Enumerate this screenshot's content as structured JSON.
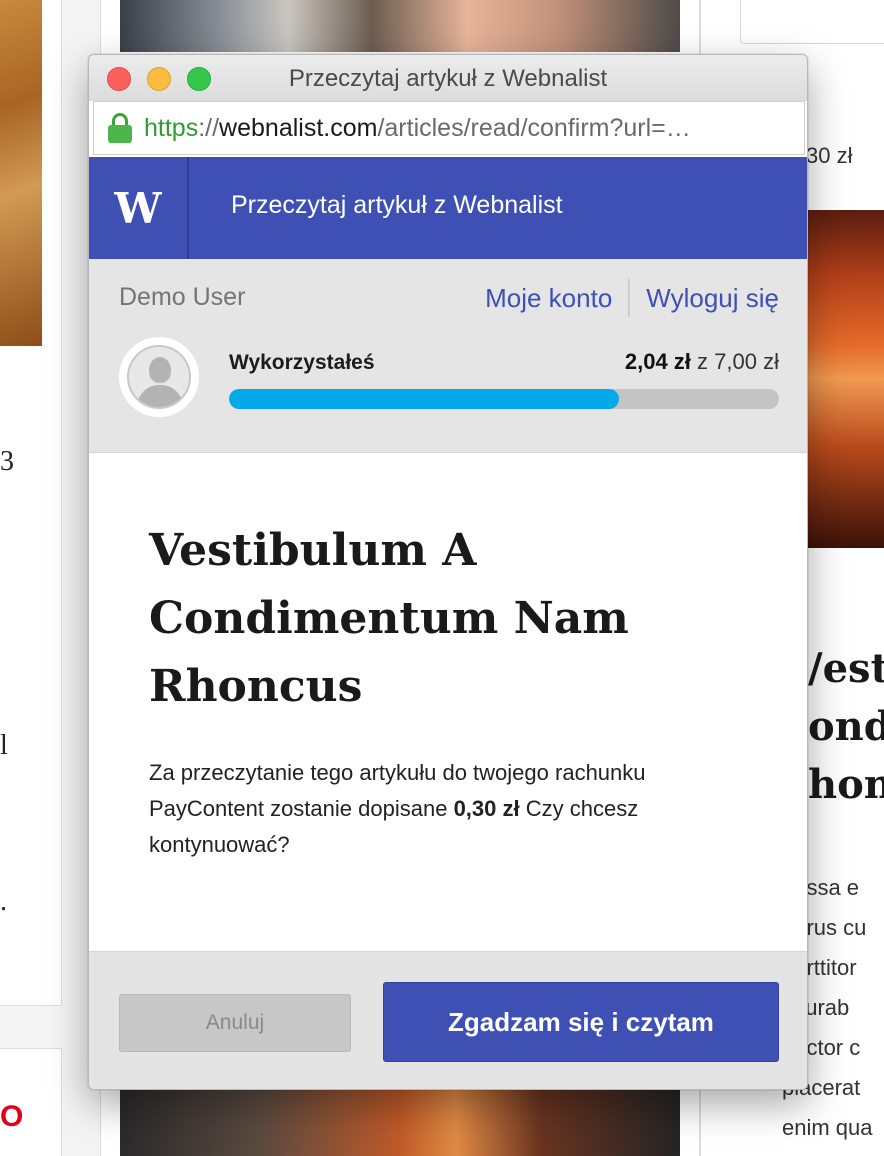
{
  "background": {
    "left_fragments": [
      "3",
      "l",
      "."
    ],
    "left_red_fragment": "O",
    "right_price_fragment": "30 zł",
    "right_title_fragment": "/esti\nond\nhon",
    "right_text_fragment": "  assa e\n  urus cu\n  orttitor\n  curab\n  uctor c\nplacerat\nenim qua"
  },
  "window": {
    "title": "Przeczytaj artykuł z Webnalist",
    "url": {
      "scheme": "https",
      "separator": "://",
      "host": "webnalist.com",
      "path": "/articles/read/confirm?url=…"
    }
  },
  "app": {
    "logo_letter": "W",
    "header_title": "Przeczytaj artykuł z Webnalist"
  },
  "account": {
    "username": "Demo User",
    "my_account_link": "Moje konto",
    "logout_link": "Wyloguj się",
    "used_label": "Wykorzystałeś",
    "used_value": "2,04 zł",
    "used_separator": "z",
    "limit_value": "7,00 zł",
    "progress_fraction": 0.709
  },
  "article": {
    "title": "Vestibulum A Condimentum Nam Rhoncus",
    "desc_before": "Za przeczytanie tego artykułu do twojego rachunku PayContent zostanie dopisane",
    "price": "0,30 zł",
    "desc_after": "Czy chcesz kontynuować?"
  },
  "actions": {
    "cancel_label": "Anuluj",
    "accept_label": "Zgadzam się i czytam"
  },
  "colors": {
    "brand": "#3e50b4",
    "progress": "#03a9e8",
    "secure_green": "#2f9e2f"
  }
}
